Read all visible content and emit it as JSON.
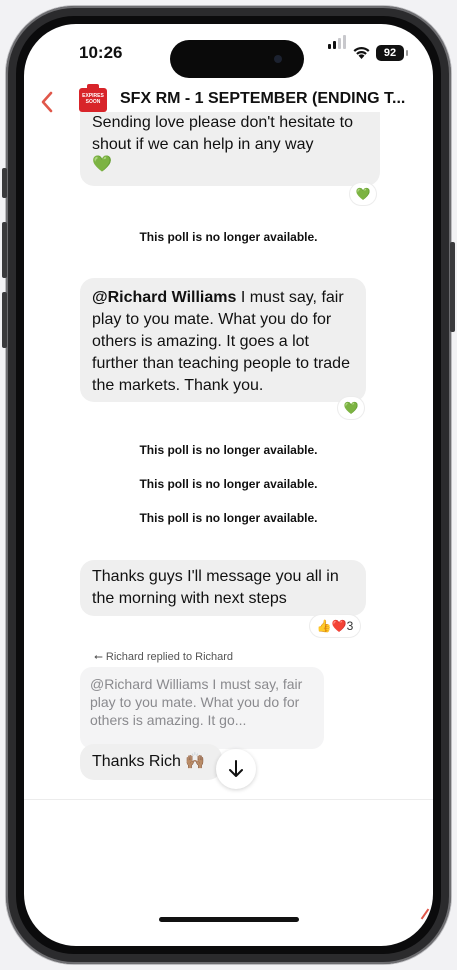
{
  "status_bar": {
    "time": "10:26",
    "battery": "92"
  },
  "header": {
    "title": "SFX RM - 1 SEPTEMBER (ENDING T...",
    "logo_text": "EXPIRES SOON"
  },
  "messages": [
    {
      "text": "Sending love please don't hesitate to shout if we can help in any way",
      "emoji": "💚",
      "reaction": "💚"
    },
    {
      "mention": "@Richard Williams",
      "text": " I must say, fair play to you mate. What you do for others is amazing. It goes a lot further than teaching people to trade the markets. Thank you.",
      "reaction": "💚"
    },
    {
      "text": "Thanks guys I'll message you all in the morning with next steps",
      "reaction_emojis": "👍❤️",
      "reaction_count": "3"
    }
  ],
  "system": {
    "poll_1": "This poll is no longer available.",
    "poll_2": "This poll is no longer available.",
    "poll_3": "This poll is no longer available.",
    "poll_4": "This poll is no longer available."
  },
  "reply": {
    "header": "Richard replied to Richard",
    "quoted_text": "@Richard Williams I must say, fair play to you mate. What you do for others is amazing. It go...",
    "text": "Thanks Rich",
    "emoji": "🙌🏽"
  },
  "icons": {
    "back": "chevron-left-icon",
    "scroll": "arrow-down-icon",
    "reply": "reply-arrow-icon"
  },
  "colors": {
    "accent": "#e0574a",
    "bubble": "#efefef",
    "logo": "#d8242a"
  }
}
